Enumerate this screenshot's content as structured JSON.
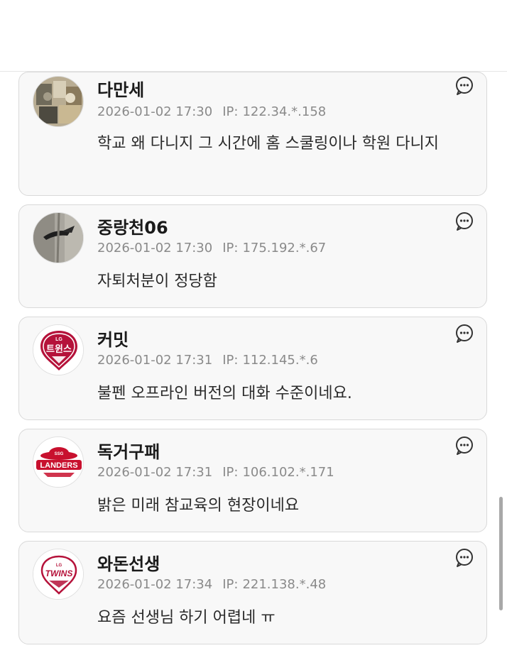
{
  "comments": [
    {
      "nickname": "다만세",
      "datetime": "2026-01-02 17:30",
      "ip_label": "IP:",
      "ip": "122.34.*.158",
      "text": "학교 왜 다니지 그 시간에 홈 스쿨링이나 학원 다니지",
      "avatar": "photo-avatar"
    },
    {
      "nickname": "중랑천06",
      "datetime": "2026-01-02 17:30",
      "ip_label": "IP:",
      "ip": "175.192.*.67",
      "text": "자퇴처분이 정당함",
      "avatar": "bird-photo-avatar"
    },
    {
      "nickname": "커밋",
      "datetime": "2026-01-02 17:31",
      "ip_label": "IP:",
      "ip": "112.145.*.6",
      "text": "불펜 오프라인 버전의 대화 수준이네요.",
      "avatar": "lg-twins-korean-logo"
    },
    {
      "nickname": "독거구패",
      "datetime": "2026-01-02 17:31",
      "ip_label": "IP:",
      "ip": "106.102.*.171",
      "text": "밝은 미래 참교육의 현장이네요",
      "avatar": "ssg-landers-logo"
    },
    {
      "nickname": "와돈선생",
      "datetime": "2026-01-02 17:34",
      "ip_label": "IP:",
      "ip": "221.138.*.48",
      "text": "요즘 선생님 하기 어렵네 ㅠ",
      "avatar": "lg-twins-logo"
    }
  ],
  "logos": {
    "lg_small": "LG",
    "twins_kr": "트윈스",
    "landers": "LANDERS",
    "ssg": "SSG",
    "twins_en": "TWINS"
  },
  "colors": {
    "card_bg": "#f8f8f8",
    "card_border": "#d9d9d9",
    "meta_text": "#8a8a8a",
    "twins_red": "#b5123a",
    "landers_red": "#c8102e"
  }
}
